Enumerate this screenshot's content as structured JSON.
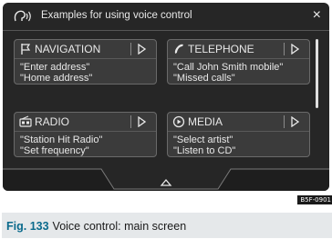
{
  "header": {
    "title": "Examples for using voice control",
    "close_label": "×"
  },
  "tiles": [
    {
      "label": "NAVIGATION",
      "icon": "flag-icon",
      "lines": [
        "\"Enter address\"",
        "\"Home address\""
      ]
    },
    {
      "label": "TELEPHONE",
      "icon": "phone-icon",
      "lines": [
        "\"Call John Smith mobile\"",
        "\"Missed calls\""
      ]
    },
    {
      "label": "RADIO",
      "icon": "radio-icon",
      "lines": [
        "\"Station Hit Radio\"",
        "\"Set frequency\""
      ]
    },
    {
      "label": "MEDIA",
      "icon": "media-play-icon",
      "lines": [
        "\"Select artist\"",
        "\"Listen to CD\""
      ]
    }
  ],
  "image_code": "B5F-0901",
  "caption": {
    "fig_label": "Fig. 133",
    "text": "Voice control: main screen"
  },
  "colors": {
    "screen_bg": "#262626",
    "tile_bg": "#3b3b3b",
    "text": "#e8e8e8",
    "caption_bg": "#e5e8ea",
    "fig_label": "#0a6a8c"
  }
}
